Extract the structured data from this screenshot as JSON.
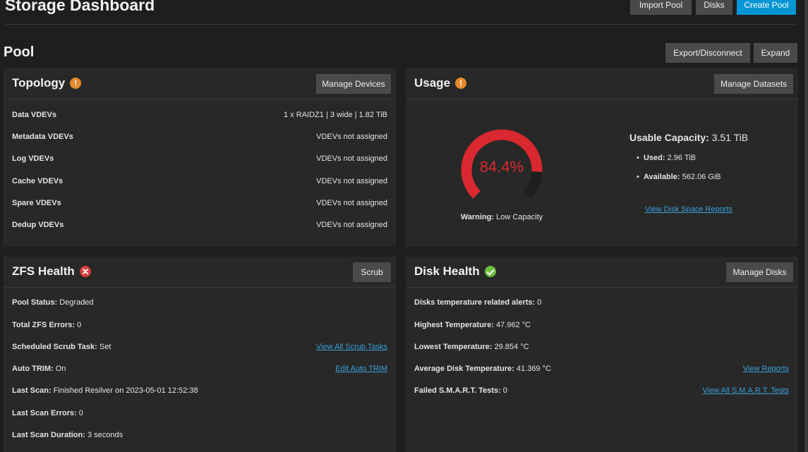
{
  "header": {
    "title": "Storage Dashboard",
    "import_pool": "Import Pool",
    "disks": "Disks",
    "create_pool": "Create Pool"
  },
  "pool": {
    "title": "Pool",
    "export_disconnect": "Export/Disconnect",
    "expand": "Expand"
  },
  "topology": {
    "title": "Topology",
    "manage_button": "Manage Devices",
    "rows": [
      {
        "label": "Data VDEVs",
        "value": "1 x RAIDZ1 | 3 wide | 1.82 TiB"
      },
      {
        "label": "Metadata VDEVs",
        "value": "VDEVs not assigned"
      },
      {
        "label": "Log VDEVs",
        "value": "VDEVs not assigned"
      },
      {
        "label": "Cache VDEVs",
        "value": "VDEVs not assigned"
      },
      {
        "label": "Spare VDEVs",
        "value": "VDEVs not assigned"
      },
      {
        "label": "Dedup VDEVs",
        "value": "VDEVs not assigned"
      }
    ]
  },
  "usage": {
    "title": "Usage",
    "manage_button": "Manage Datasets",
    "percent_text": "84.4%",
    "percent": 84.4,
    "warning_label": "Warning:",
    "warning_value": "Low Capacity",
    "capacity_label": "Usable Capacity:",
    "capacity_value": "3.51 TiB",
    "used_label": "Used:",
    "used_value": "2.96 TiB",
    "available_label": "Available:",
    "available_value": "562.06 GiB",
    "reports_link": "View Disk Space Reports",
    "gauge_color": "#d9282f"
  },
  "zfs": {
    "title": "ZFS Health",
    "scrub_button": "Scrub",
    "pool_status_label": "Pool Status:",
    "pool_status_value": "Degraded",
    "errors_label": "Total ZFS Errors:",
    "errors_value": "0",
    "scrub_task_label": "Scheduled Scrub Task:",
    "scrub_task_value": "Set",
    "scrub_link": "View All Scrub Tasks",
    "trim_label": "Auto TRIM:",
    "trim_value": "On",
    "trim_link": "Edit Auto TRIM",
    "last_scan_label": "Last Scan:",
    "last_scan_value": "Finished Resilver on 2023-05-01 12:52:38",
    "scan_errors_label": "Last Scan Errors:",
    "scan_errors_value": "0",
    "scan_duration_label": "Last Scan Duration:",
    "scan_duration_value": "3 seconds"
  },
  "disk": {
    "title": "Disk Health",
    "manage_button": "Manage Disks",
    "temp_alerts_label": "Disks temperature related alerts:",
    "temp_alerts_value": "0",
    "highest_label": "Highest Temperature:",
    "highest_value": "47.962 °C",
    "lowest_label": "Lowest Temperature:",
    "lowest_value": "29.854 °C",
    "average_label": "Average Disk Temperature:",
    "average_value": "41.369 °C",
    "reports_link": "View Reports",
    "smart_label": "Failed S.M.A.R.T. Tests:",
    "smart_value": "0",
    "smart_link": "View All S.M.A.R.T. Tests"
  }
}
